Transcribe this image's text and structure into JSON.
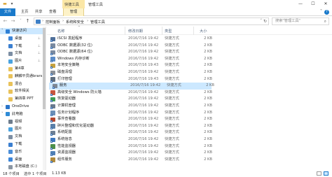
{
  "window": {
    "title": "管理工具",
    "contextual_group": "快捷工具",
    "minimize": "—",
    "maximize": "☐",
    "close": "✕",
    "accent": "#1979ca"
  },
  "ribbon": {
    "tabs": [
      "文件",
      "主页",
      "共享",
      "查看",
      "管理"
    ],
    "help": "?",
    "collapse": "˅"
  },
  "address": {
    "path": [
      "控制面板",
      "系统和安全",
      "管理工具"
    ],
    "search_placeholder": "搜索\"管理工具\""
  },
  "nav": [
    {
      "label": "快速访问",
      "color": "#2e7fd4",
      "indent": 1,
      "expand": "˅",
      "selected": true
    },
    {
      "label": "桌面",
      "color": "#3d86d9",
      "indent": 2,
      "pin": "📌"
    },
    {
      "label": "下载",
      "color": "#3b7fd0",
      "indent": 2,
      "pin": "📌"
    },
    {
      "label": "文档",
      "color": "#7c8ea3",
      "indent": 2,
      "pin": "📌"
    },
    {
      "label": "图片",
      "color": "#4aa3e0",
      "indent": 2,
      "pin": "📌"
    },
    {
      "label": "第4章",
      "color": "#e9c25a",
      "indent": 2
    },
    {
      "label": "麒麟平员通brars",
      "color": "#e9c25a",
      "indent": 2
    },
    {
      "label": "混合",
      "color": "#e9c25a",
      "indent": 2
    },
    {
      "label": "软件相关",
      "color": "#e9c25a",
      "indent": 2
    },
    {
      "label": "第四章 PPT",
      "color": "#e9c25a",
      "indent": 2
    },
    {
      "label": "OneDrive",
      "color": "#2a75c9",
      "indent": 1,
      "expand": "›"
    },
    {
      "label": "此电脑",
      "color": "#2f8bd6",
      "indent": 1,
      "expand": "˅"
    },
    {
      "label": "视频",
      "color": "#6e7c8c",
      "indent": 2
    },
    {
      "label": "图片",
      "color": "#4aa3e0",
      "indent": 2
    },
    {
      "label": "文档",
      "color": "#7c8ea3",
      "indent": 2
    },
    {
      "label": "下载",
      "color": "#3b7fd0",
      "indent": 2
    },
    {
      "label": "音乐",
      "color": "#4d8fd8",
      "indent": 2
    },
    {
      "label": "桌面",
      "color": "#3d86d9",
      "indent": 2
    },
    {
      "label": "本地磁盘 (C:)",
      "color": "#8a96a3",
      "indent": 2
    }
  ],
  "columns": {
    "name": "名称",
    "date": "修改日期",
    "type": "类型",
    "size": "大小",
    "sort_glyph": "^"
  },
  "files": [
    {
      "name": "iSCSI 发起程序",
      "date": "2016/7/16 19:42",
      "type": "快捷方式",
      "size": "2 KB",
      "color": "#4f6f9a"
    },
    {
      "name": "ODBC 数据源(32 位)",
      "date": "2016/7/16 19:42",
      "type": "快捷方式",
      "size": "2 KB",
      "color": "#7a8aa0"
    },
    {
      "name": "ODBC 数据源(64 位)",
      "date": "2016/7/16 19:42",
      "type": "快捷方式",
      "size": "2 KB",
      "color": "#7a8aa0"
    },
    {
      "name": "Windows 内存诊断",
      "date": "2016/7/16 19:42",
      "type": "快捷方式",
      "size": "2 KB",
      "color": "#5a8bc8"
    },
    {
      "name": "本地安全策略",
      "date": "2016/7/16 19:43",
      "type": "快捷方式",
      "size": "2 KB",
      "color": "#c5a13f"
    },
    {
      "name": "磁盘清理",
      "date": "2016/7/16 19:42",
      "type": "快捷方式",
      "size": "2 KB",
      "color": "#8a8f96"
    },
    {
      "name": "打印管理",
      "date": "2016/7/16 19:43",
      "type": "快捷方式",
      "size": "2 KB",
      "color": "#5e6d7e"
    },
    {
      "name": "服务",
      "date": "2016/7/16 19:42",
      "type": "快捷方式",
      "size": "2 KB",
      "color": "#7d8793",
      "selected": true
    },
    {
      "name": "高级安全 Windows 防火墙",
      "date": "2016/7/16 19:42",
      "type": "快捷方式",
      "size": "2 KB",
      "color": "#c8553d"
    },
    {
      "name": "恢复驱动器",
      "date": "2016/7/16 19:42",
      "type": "快捷方式",
      "size": "2 KB",
      "color": "#3f9b55"
    },
    {
      "name": "计算机管理",
      "date": "2016/7/16 19:42",
      "type": "快捷方式",
      "size": "2 KB",
      "color": "#6a7a8e"
    },
    {
      "name": "任务计划程序",
      "date": "2016/7/16 19:42",
      "type": "快捷方式",
      "size": "2 KB",
      "color": "#6a8fb7"
    },
    {
      "name": "事件查看器",
      "date": "2016/7/16 19:42",
      "type": "快捷方式",
      "size": "2 KB",
      "color": "#b4472f"
    },
    {
      "name": "碎片整理和优化驱动器",
      "date": "2016/7/16 19:42",
      "type": "快捷方式",
      "size": "2 KB",
      "color": "#5a7fa8"
    },
    {
      "name": "系统配置",
      "date": "2016/7/16 19:42",
      "type": "快捷方式",
      "size": "2 KB",
      "color": "#6d7f94"
    },
    {
      "name": "系统信息",
      "date": "2016/7/16 19:42",
      "type": "快捷方式",
      "size": "2 KB",
      "color": "#3c78c0"
    },
    {
      "name": "性能监视器",
      "date": "2016/7/16 19:42",
      "type": "快捷方式",
      "size": "2 KB",
      "color": "#4e8f4a"
    },
    {
      "name": "资源监视器",
      "date": "2016/7/16 19:42",
      "type": "快捷方式",
      "size": "2 KB",
      "color": "#4f7fb5"
    },
    {
      "name": "组件服务",
      "date": "2016/7/16 19:42",
      "type": "快捷方式",
      "size": "2 KB",
      "color": "#b08a3c"
    }
  ],
  "status": {
    "count": "18 个项目",
    "selected": "选中 1 个项目",
    "size": "1.13 KB"
  }
}
